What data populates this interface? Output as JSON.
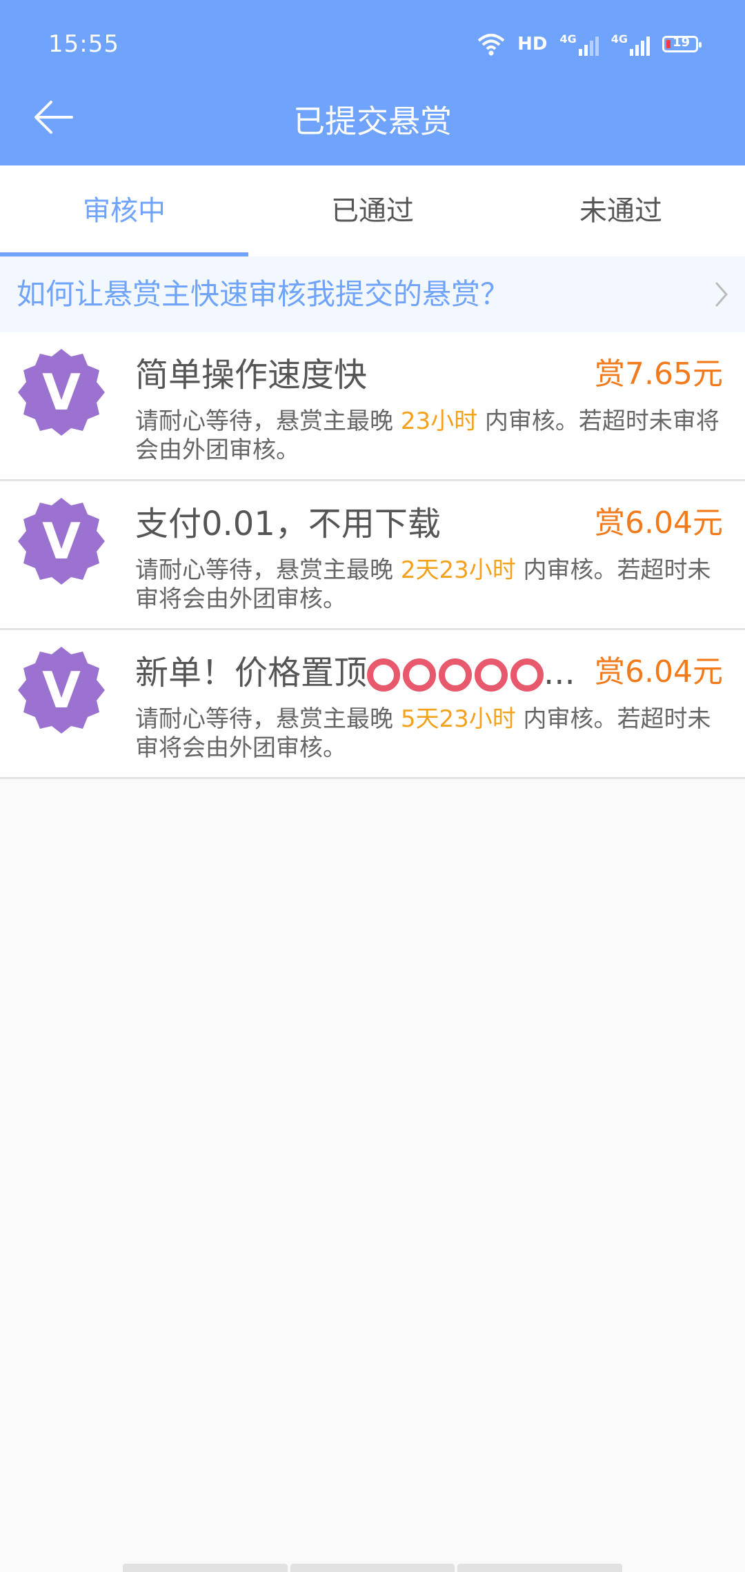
{
  "status_bar": {
    "time": "15:55",
    "network": "HD",
    "signal_1": "4G",
    "signal_2": "4G",
    "battery": "19"
  },
  "header": {
    "title": "已提交悬赏"
  },
  "tabs": [
    {
      "label": "审核中",
      "active": true
    },
    {
      "label": "已通过",
      "active": false
    },
    {
      "label": "未通过",
      "active": false
    }
  ],
  "tip": {
    "text": "如何让悬赏主快速审核我提交的悬赏？"
  },
  "items": [
    {
      "avatar": "V",
      "title": "简单操作速度快",
      "reward": "赏7.65元",
      "desc_prefix": "请耐心等待，悬赏主最晚",
      "desc_time": "23小时",
      "desc_suffix": "内审核。若超时未审将会由外团审核。"
    },
    {
      "avatar": "V",
      "title": "支付0.01，不用下载",
      "reward": "赏6.04元",
      "desc_prefix": "请耐心等待，悬赏主最晚",
      "desc_time": "2天23小时",
      "desc_suffix": "内审核。若超时未审将会由外团审核。"
    },
    {
      "avatar": "V",
      "title": "新单！价格置顶",
      "title_ellipsis": "...",
      "reward": "赏6.04元",
      "desc_prefix": "请耐心等待，悬赏主最晚",
      "desc_time": "5天23小时",
      "desc_suffix": "内审核。若超时未审将会由外团审核。"
    }
  ],
  "colors": {
    "primary": "#6fa3fc",
    "reward": "#f27a1a",
    "highlight": "#f4a11c",
    "avatar": "#9b72cf"
  }
}
